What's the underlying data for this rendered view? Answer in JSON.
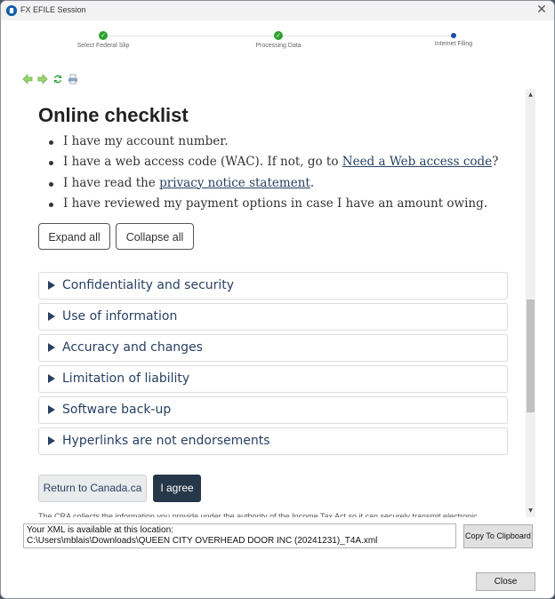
{
  "window": {
    "title": "FX EFILE Session",
    "close_glyph": "✕"
  },
  "stepper": {
    "steps": [
      {
        "label": "Select Federal Slip",
        "status": "done",
        "glyph": "✓"
      },
      {
        "label": "Processing Data",
        "status": "done",
        "glyph": "✓"
      },
      {
        "label": "Internet Filing",
        "status": "current"
      }
    ],
    "colors": {
      "done": "#2ea12e",
      "current": "#1b4f9a"
    }
  },
  "toolbar": {
    "icons": [
      "arrow-left-icon",
      "arrow-right-icon",
      "refresh-icon",
      "print-icon"
    ]
  },
  "page": {
    "heading": "Online checklist",
    "checklist": [
      {
        "text": "I have my account number."
      },
      {
        "before": "I have a web access code (WAC). If not, go to ",
        "link": "Need a Web access code",
        "after": "?"
      },
      {
        "before": "I have read the ",
        "link": "privacy notice statement",
        "after": "."
      },
      {
        "text": "I have reviewed my payment options in case I have an amount owing."
      }
    ],
    "expand_all": "Expand all",
    "collapse_all": "Collapse all",
    "sections": [
      "Confidentiality and security",
      "Use of information",
      "Accuracy and changes",
      "Limitation of liability",
      "Software back-up",
      "Hyperlinks are not endorsements"
    ],
    "return_button": "Return to Canada.ca",
    "agree_button": "I agree",
    "footer_text": "The CRA collects the information you provide under the authority of the Income Tax Act so it can securely transmit electronic",
    "scroll_position_fraction": 0.49
  },
  "xml_info": {
    "line1": "Your XML is available at this location:",
    "line2": "C:\\Users\\mblais\\Downloads\\QUEEN CITY OVERHEAD DOOR INC (20241231)_T4A.xml"
  },
  "buttons": {
    "copy": "Copy To Clipboard",
    "close": "Close"
  },
  "colors": {
    "link": "#284162",
    "agree_bg": "#26374a"
  }
}
